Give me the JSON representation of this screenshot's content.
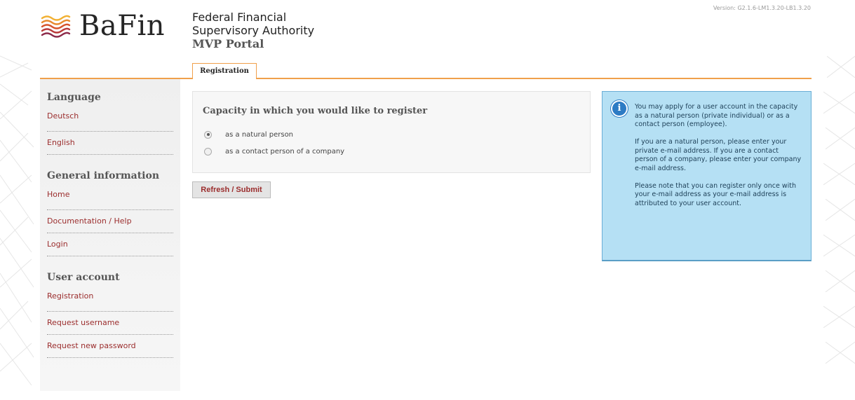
{
  "header": {
    "logo_text": "BaFin",
    "org_line1": "Federal Financial",
    "org_line2": "Supervisory Authority",
    "portal_name": "MVP Portal",
    "version": "Version: G2.1.6-LM1.3.20-LB1.3.20"
  },
  "tabs": [
    {
      "label": "Registration",
      "active": true
    }
  ],
  "sidebar": {
    "sections": [
      {
        "heading": "Language",
        "links": [
          "Deutsch",
          "English"
        ]
      },
      {
        "heading": "General information",
        "links": [
          "Home",
          "Documentation / Help",
          "Login"
        ]
      },
      {
        "heading": "User account",
        "links": [
          "Registration",
          "Request username",
          "Request new password"
        ]
      }
    ]
  },
  "form": {
    "title": "Capacity in which you would like to register",
    "options": [
      {
        "label": "as a natural person",
        "checked": true
      },
      {
        "label": "as a contact person of a company",
        "checked": false
      }
    ],
    "submit_label": "Refresh / Submit"
  },
  "info": {
    "icon": "info-icon",
    "paragraphs": [
      "You may apply for a user account in the capacity as a natural person (private individual) or as a contact person (employee).",
      "If you are a natural person, please enter your private e-mail address. If you are a contact person of a company, please enter your company e-mail address.",
      "Please note that you can register only once with your e-mail address as your e-mail address is attributed to your user account."
    ]
  },
  "colors": {
    "accent": "#f0a04b",
    "link": "#9b2d2d",
    "info_bg": "#b5e0f4"
  }
}
